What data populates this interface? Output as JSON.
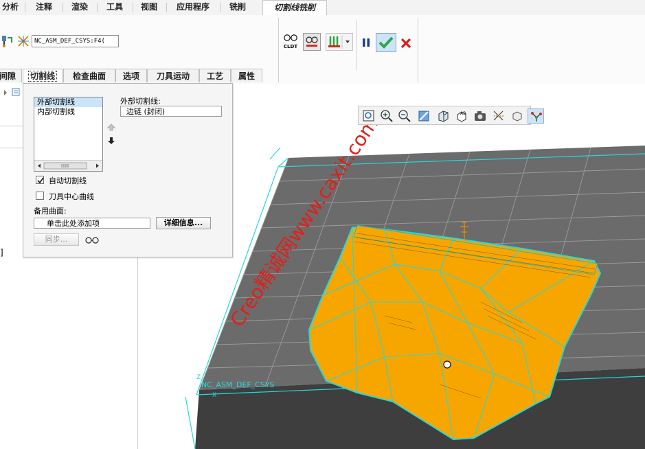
{
  "ribbon": {
    "tabs": [
      "分析",
      "注释",
      "渲染",
      "工具",
      "视图",
      "应用程序",
      "铣削"
    ],
    "active_tab": "切割线铣削"
  },
  "coord_system_field": "NC_ASM_DEF_CSYS:F4(",
  "toolbar": {
    "cldt_label": "CLDT",
    "icons": [
      "glasses-icon",
      "display-toolpath-icon",
      "toolpath-dropdown-icon",
      "pause-icon",
      "confirm-check-icon",
      "cancel-x-icon"
    ]
  },
  "subtabs": [
    "间隙",
    "切割线",
    "检查曲面",
    "选项",
    "刀具运动",
    "工艺",
    "属性"
  ],
  "active_subtab": "切割线",
  "cutline_panel": {
    "list_items": [
      "外部切割线",
      "内部切割线"
    ],
    "selected_item": "外部切割线",
    "outer_label": "外部切割线:",
    "outer_value": "边链 (封闭)",
    "auto_cutline_label": "自动切割线",
    "auto_cutline_checked": true,
    "tool_center_label": "刀具中心曲线",
    "tool_center_checked": false,
    "alt_surface_label": "备用曲面:",
    "alt_surface_placeholder": "单击此处添加项",
    "details_button": "详细信息...",
    "sync_button": "同步..."
  },
  "left_tree": {
    "bracket_text": "]"
  },
  "viewport": {
    "csys_label": "NC_ASM_DEF_CSYS",
    "axis_x": "X",
    "axis_z": "Z",
    "watermark": "Creo精诚网www.caxit.com",
    "colors": {
      "part_orange": "#f7a600",
      "wire_cyan": "#25d8dc",
      "stock_gray": "#6b6b6b",
      "stock_dark": "#3e3e3e",
      "watermark_red": "#e0201a",
      "accept_green": "#2da845",
      "cancel_red": "#d91b1b"
    }
  },
  "view_toolbar": {
    "icons": [
      "refit-icon",
      "zoom-in-icon",
      "zoom-out-icon",
      "repaint-icon",
      "display-style-icon",
      "saved-orientations-icon",
      "view-manager-icon",
      "datum-display-icon",
      "spin-center-icon",
      "toolpath-display-icon"
    ],
    "active_icon": "toolpath-display-icon"
  }
}
